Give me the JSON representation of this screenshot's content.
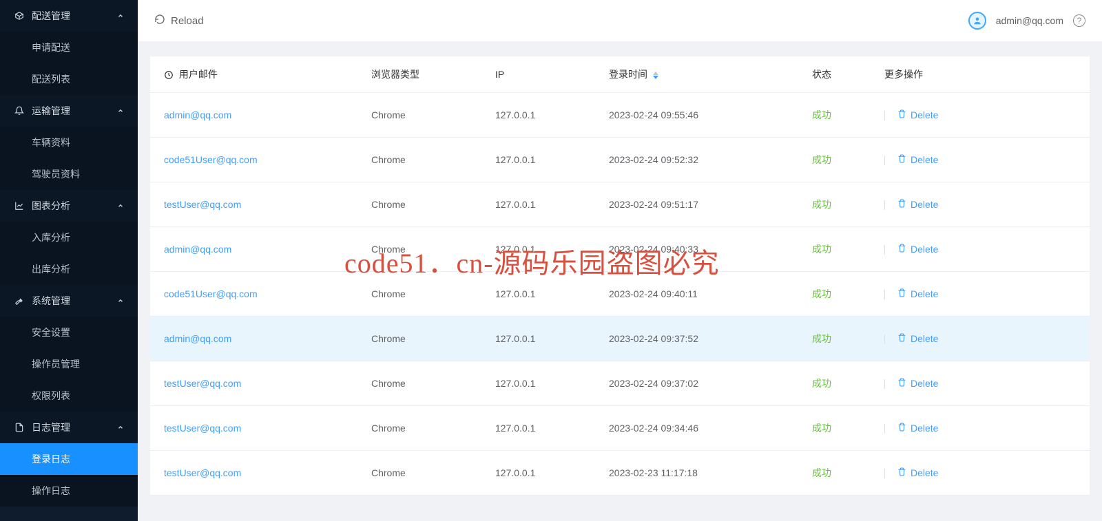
{
  "topbar": {
    "reload_label": "Reload",
    "user_email": "admin@qq.com"
  },
  "watermark": "code51．cn-源码乐园盗图必究",
  "sidebar": {
    "groups": [
      {
        "label": "配送管理",
        "icon": "package",
        "items": [
          {
            "label": "申请配送"
          },
          {
            "label": "配送列表"
          }
        ]
      },
      {
        "label": "运输管理",
        "icon": "bell",
        "items": [
          {
            "label": "车辆资料"
          },
          {
            "label": "驾驶员资料"
          }
        ]
      },
      {
        "label": "图表分析",
        "icon": "chart",
        "items": [
          {
            "label": "入库分析"
          },
          {
            "label": "出库分析"
          }
        ]
      },
      {
        "label": "系统管理",
        "icon": "wrench",
        "items": [
          {
            "label": "安全设置"
          },
          {
            "label": "操作员管理"
          },
          {
            "label": "权限列表"
          }
        ]
      },
      {
        "label": "日志管理",
        "icon": "file",
        "items": [
          {
            "label": "登录日志",
            "active": true
          },
          {
            "label": "操作日志"
          }
        ]
      }
    ]
  },
  "table": {
    "columns": {
      "email": "用户邮件",
      "browser": "浏览器类型",
      "ip": "IP",
      "login_time": "登录时间",
      "status": "状态",
      "actions": "更多操作"
    },
    "delete_label": "Delete",
    "rows": [
      {
        "email": "admin@qq.com",
        "browser": "Chrome",
        "ip": "127.0.0.1",
        "login_time": "2023-02-24 09:55:46",
        "status": "成功"
      },
      {
        "email": "code51User@qq.com",
        "browser": "Chrome",
        "ip": "127.0.0.1",
        "login_time": "2023-02-24 09:52:32",
        "status": "成功"
      },
      {
        "email": "testUser@qq.com",
        "browser": "Chrome",
        "ip": "127.0.0.1",
        "login_time": "2023-02-24 09:51:17",
        "status": "成功"
      },
      {
        "email": "admin@qq.com",
        "browser": "Chrome",
        "ip": "127.0.0.1",
        "login_time": "2023-02-24 09:40:33",
        "status": "成功"
      },
      {
        "email": "code51User@qq.com",
        "browser": "Chrome",
        "ip": "127.0.0.1",
        "login_time": "2023-02-24 09:40:11",
        "status": "成功"
      },
      {
        "email": "admin@qq.com",
        "browser": "Chrome",
        "ip": "127.0.0.1",
        "login_time": "2023-02-24 09:37:52",
        "status": "成功",
        "highlight": true
      },
      {
        "email": "testUser@qq.com",
        "browser": "Chrome",
        "ip": "127.0.0.1",
        "login_time": "2023-02-24 09:37:02",
        "status": "成功"
      },
      {
        "email": "testUser@qq.com",
        "browser": "Chrome",
        "ip": "127.0.0.1",
        "login_time": "2023-02-24 09:34:46",
        "status": "成功"
      },
      {
        "email": "testUser@qq.com",
        "browser": "Chrome",
        "ip": "127.0.0.1",
        "login_time": "2023-02-23 11:17:18",
        "status": "成功"
      }
    ]
  }
}
